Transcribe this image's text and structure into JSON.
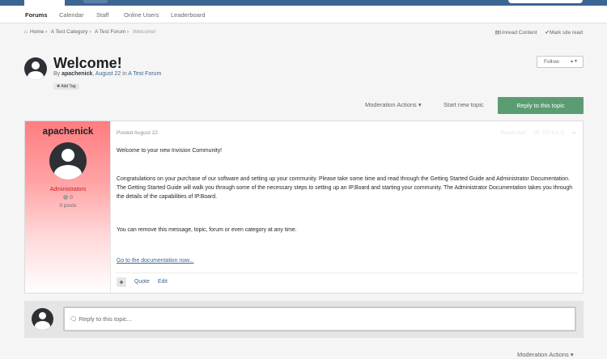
{
  "nav": {
    "items": [
      "Forums",
      "Calendar",
      "Staff",
      "Online Users",
      "Leaderboard"
    ]
  },
  "breadcrumb": {
    "home": "Home",
    "category": "A Test Category",
    "forum": "A Test Forum",
    "current": "Welcome!",
    "unread": "Unread Content",
    "mark_read": "Mark site read"
  },
  "topic": {
    "title": "Welcome!",
    "by": "By",
    "author": "apachenick",
    "date": "August 22",
    "in": "in",
    "forum": "A Test Forum",
    "add_tag": "Add Tag",
    "follow": "Follow"
  },
  "actions": {
    "moderation": "Moderation Actions",
    "start_new": "Start new topic",
    "reply": "Reply to this topic"
  },
  "post": {
    "author": "apachenick",
    "group": "Administrators",
    "reputation": "0",
    "post_count": "0 posts",
    "posted": "Posted August 22",
    "meta_report": "Report post",
    "meta_ip": "(IP: 127.0.0.1)",
    "body": [
      "Welcome to your new Invision Community!",
      "Congratulations on your purchase of our software and setting up your community. Please take some time and read through the Getting Started Guide and Administrator Documentation. The Getting Started Guide will walk you through some of the necessary steps to setting up an IP.Board and starting your community. The Administrator Documentation takes you through the details of the capabilities of IP.Board.",
      "You can remove this message, topic, forum or even category at any time.",
      "Go to the documentation now..."
    ],
    "quote": "Quote",
    "edit": "Edit"
  },
  "reply": {
    "placeholder": "Reply to this topic..."
  },
  "bottom": {
    "moderation": "Moderation Actions"
  },
  "colors": {
    "brand": "#3d6594",
    "reply_button": "#5b9d73",
    "admin_group": "#c81e1e",
    "aside_top": "#ff7d80"
  },
  "icons": [
    "home-icon",
    "unread-icon",
    "check-icon",
    "share-icon",
    "plus-icon",
    "comment-icon",
    "chevron-down-icon"
  ]
}
